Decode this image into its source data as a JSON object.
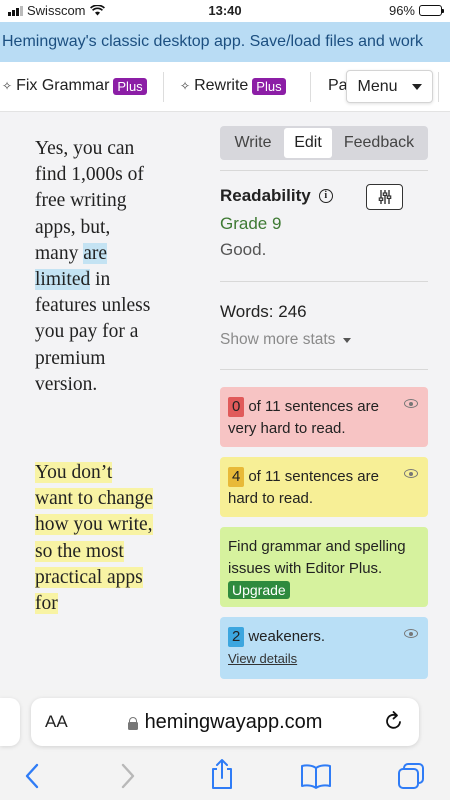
{
  "status_bar": {
    "carrier": "Swisscom",
    "time": "13:40",
    "battery": "96%"
  },
  "banner": {
    "text": "Hemingway's classic desktop app. Save/load files and work"
  },
  "toolbar": {
    "fix_grammar": "Fix Grammar",
    "fix_grammar_badge": "Plus",
    "rewrite": "Rewrite",
    "rewrite_badge": "Plus",
    "partial": "Pa",
    "menu": "Menu"
  },
  "editor": {
    "para1_before": "Yes, you can find 1,000s of free writing apps, but, many ",
    "para1_highlight": "are limited",
    "para1_after": " in features unless you pay for a premium version.",
    "para2_highlight": "You don’t want to change how you write, so the most practical apps for"
  },
  "panel": {
    "tabs": [
      "Write",
      "Edit",
      "Feedback"
    ],
    "active_tab": "Edit",
    "readability_label": "Readability",
    "grade": "Grade 9",
    "grade_comment": "Good.",
    "words_label": "Words: 246",
    "show_more_stats": "Show more stats",
    "cards": {
      "very_hard": {
        "count": "0",
        "text": "of 11 sentences are very hard to read."
      },
      "hard": {
        "count": "4",
        "text": "of 11 sentences are hard to read."
      },
      "grammar": {
        "text": "Find grammar and spelling issues with Editor Plus.",
        "button": "Upgrade"
      },
      "weakeners": {
        "count": "2",
        "text": "weakeners.",
        "link": "View details"
      }
    }
  },
  "browser": {
    "text_size_label": "AA",
    "url": "hemingwayapp.com"
  },
  "colors": {
    "plus_badge": "#8c1ea6",
    "grade_green": "#3e7a33",
    "very_hard_bg": "#f7c4c4",
    "hard_bg": "#f7ef96",
    "grammar_bg": "#d6f29e",
    "weakeners_bg": "#b9dff6",
    "ios_blue": "#2f7cf6"
  }
}
